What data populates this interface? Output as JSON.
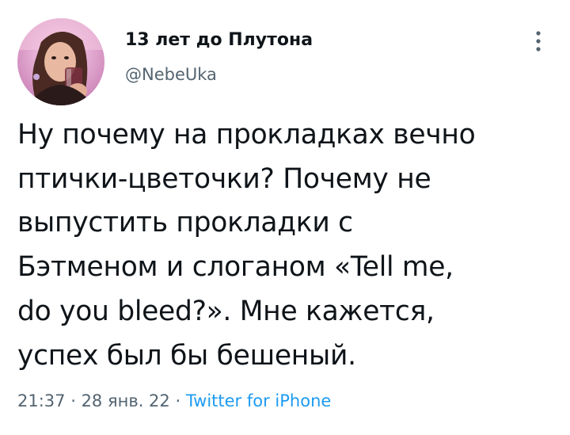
{
  "author": {
    "display_name": "13 лет до Плутона",
    "handle": "@NebeUka",
    "avatar_icon": "profile-photo-avatar"
  },
  "tweet": {
    "lines": [
      "Ну почему на прокладках вечно",
      "птички-цветочки? Почему не",
      "выпустить прокладки с",
      "Бэтменом и слоганом «Tell me,",
      "do you bleed?». Мне кажется,",
      "успех был бы бешеный."
    ]
  },
  "meta": {
    "time": "21:37",
    "separator": " · ",
    "date": "28 янв. 22",
    "source": "Twitter for iPhone"
  },
  "colors": {
    "text": "#0f1419",
    "secondary": "#536471",
    "link": "#1d9bf0"
  },
  "icons": {
    "more": "more-vertical-icon"
  }
}
